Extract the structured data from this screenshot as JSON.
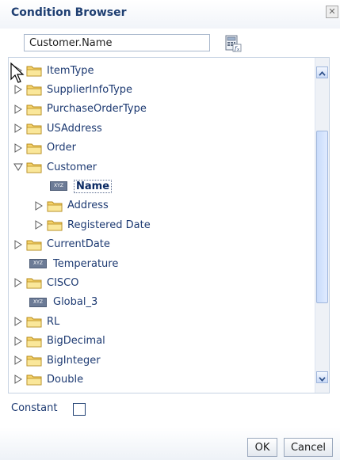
{
  "dialog": {
    "title": "Condition Browser",
    "close_symbol": "✕"
  },
  "expression": {
    "value": "Customer.Name"
  },
  "icons": {
    "close": "close-icon",
    "expression_builder": "expression-builder-icon",
    "folder": "folder-icon",
    "expand": "triangle-right-icon",
    "collapse": "triangle-down-icon",
    "scalar_type": "xyz-icon",
    "cursor": "mouse-cursor-icon"
  },
  "xyz_badge": "XYZ",
  "tree": {
    "items": [
      {
        "label": "ItemType",
        "level": 0,
        "kind": "folder",
        "state": "collapsed"
      },
      {
        "label": "SupplierInfoType",
        "level": 0,
        "kind": "folder",
        "state": "collapsed"
      },
      {
        "label": "PurchaseOrderType",
        "level": 0,
        "kind": "folder",
        "state": "collapsed"
      },
      {
        "label": "USAddress",
        "level": 0,
        "kind": "folder",
        "state": "collapsed"
      },
      {
        "label": "Order",
        "level": 0,
        "kind": "folder",
        "state": "collapsed"
      },
      {
        "label": "Customer",
        "level": 0,
        "kind": "folder",
        "state": "expanded"
      },
      {
        "label": "Name",
        "level": 1,
        "kind": "field",
        "selected": true
      },
      {
        "label": "Address",
        "level": 1,
        "kind": "folder",
        "state": "collapsed"
      },
      {
        "label": "Registered Date",
        "level": 1,
        "kind": "folder",
        "state": "collapsed"
      },
      {
        "label": "CurrentDate",
        "level": 0,
        "kind": "folder",
        "state": "collapsed"
      },
      {
        "label": "Temperature",
        "level": 0,
        "kind": "field"
      },
      {
        "label": "CISCO",
        "level": 0,
        "kind": "folder",
        "state": "collapsed"
      },
      {
        "label": "Global_3",
        "level": 0,
        "kind": "field"
      },
      {
        "label": "RL",
        "level": 0,
        "kind": "folder",
        "state": "collapsed"
      },
      {
        "label": "BigDecimal",
        "level": 0,
        "kind": "folder",
        "state": "collapsed"
      },
      {
        "label": "BigInteger",
        "level": 0,
        "kind": "folder",
        "state": "collapsed"
      },
      {
        "label": "Double",
        "level": 0,
        "kind": "folder",
        "state": "collapsed"
      }
    ]
  },
  "constant": {
    "label": "Constant",
    "checked": false
  },
  "buttons": {
    "ok": "OK",
    "cancel": "Cancel"
  },
  "colors": {
    "title_text": "#1f3f72",
    "tree_text": "#1d3a72",
    "folder_fill": "#f5d36b",
    "folder_stroke": "#b68b1e",
    "scroll_thumb": "#c9dcfb"
  }
}
